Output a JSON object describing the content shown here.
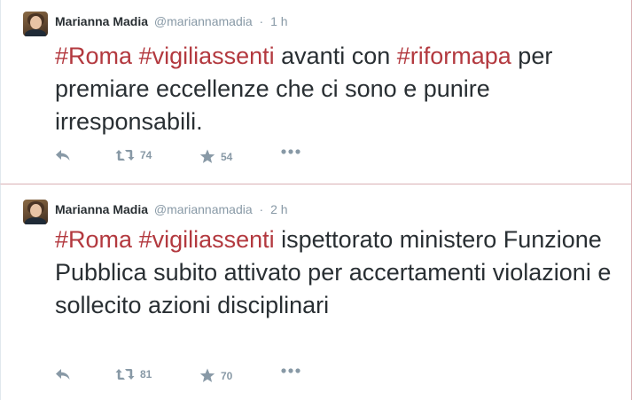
{
  "tweets": [
    {
      "fullname": "Marianna Madia",
      "username": "@mariannamadia",
      "separator": "·",
      "time": "1 h",
      "text": [
        {
          "t": "#Roma",
          "hashtag": true
        },
        {
          "t": " ",
          "hashtag": false
        },
        {
          "t": "#vigiliassenti",
          "hashtag": true
        },
        {
          "t": " avanti con ",
          "hashtag": false
        },
        {
          "t": "#riformapa",
          "hashtag": true
        },
        {
          "t": " per premiare eccellenze che ci sono e punire irresponsabili.",
          "hashtag": false
        }
      ],
      "retweets": "74",
      "favorites": "54"
    },
    {
      "fullname": "Marianna Madia",
      "username": "@mariannamadia",
      "separator": "·",
      "time": "2 h",
      "text": [
        {
          "t": "#Roma",
          "hashtag": true
        },
        {
          "t": " ",
          "hashtag": false
        },
        {
          "t": "#vigiliassenti",
          "hashtag": true
        },
        {
          "t": " ispettorato ministero Funzione Pubblica subito attivato per accertamenti violazioni e sollecito azioni disciplinari",
          "hashtag": false
        }
      ],
      "retweets": "81",
      "favorites": "70"
    }
  ],
  "icons": {
    "reply": "reply-icon",
    "retweet": "retweet-icon",
    "favorite": "star-icon",
    "more": "more-icon"
  },
  "colors": {
    "hashtag": "#b3393f",
    "text": "#292f33",
    "muted": "#8899a6"
  }
}
